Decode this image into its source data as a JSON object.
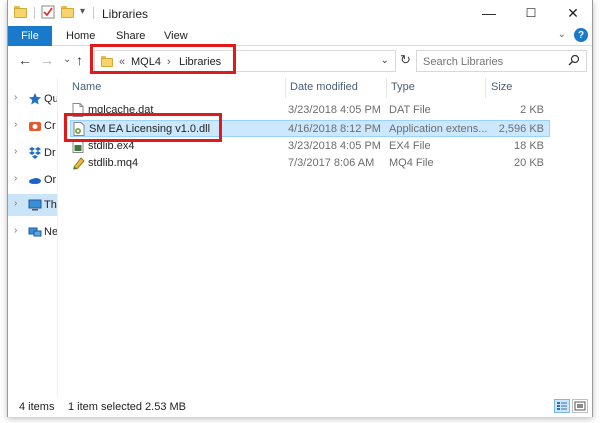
{
  "window": {
    "title": "Libraries",
    "controls": {
      "minimize": "—",
      "maximize": "☐",
      "close": "✕"
    }
  },
  "ribbon": {
    "tabs": [
      "File",
      "Home",
      "Share",
      "View"
    ],
    "expand_chevron": "⌄",
    "help": "?"
  },
  "nav": {
    "back": "←",
    "forward": "→",
    "recent": "⌄",
    "up": "↑",
    "breadcrumb": {
      "overflow": "«",
      "items": [
        "MQL4",
        "Libraries"
      ],
      "separator": "›"
    },
    "address_dropdown": "⌄",
    "refresh": "↻",
    "search_placeholder": "Search Libraries",
    "search_icon": "⚲"
  },
  "sidebar": {
    "items": [
      {
        "label": "Qu",
        "icon": "star-icon"
      },
      {
        "label": "Cr",
        "icon": "creative-cloud-icon"
      },
      {
        "label": "Dr",
        "icon": "dropbox-icon"
      },
      {
        "label": "Or",
        "icon": "onedrive-icon"
      },
      {
        "label": "Th",
        "icon": "this-pc-icon",
        "selected": true
      },
      {
        "label": "Ne",
        "icon": "network-icon"
      }
    ]
  },
  "columns": [
    "Name",
    "Date modified",
    "Type",
    "Size"
  ],
  "files": [
    {
      "name": "mqlcache.dat",
      "date": "3/23/2018 4:05 PM",
      "type": "DAT File",
      "size": "2 KB",
      "icon": "file-icon",
      "selected": false
    },
    {
      "name": "SM EA Licensing v1.0.dll",
      "date": "4/16/2018 8:12 PM",
      "type": "Application extens...",
      "size": "2,596 KB",
      "icon": "dll-file-icon",
      "selected": true
    },
    {
      "name": "stdlib.ex4",
      "date": "3/23/2018 4:05 PM",
      "type": "EX4 File",
      "size": "18 KB",
      "icon": "ex4-file-icon",
      "selected": false
    },
    {
      "name": "stdlib.mq4",
      "date": "7/3/2017 8:06 AM",
      "type": "MQ4 File",
      "size": "20 KB",
      "icon": "mq4-file-icon",
      "selected": false
    }
  ],
  "status": {
    "item_count": "4 items",
    "selection": "1 item selected  2.53 MB"
  },
  "colors": {
    "accent": "#1979ca",
    "highlight": "#e01a1a",
    "selection": "#cce8ff"
  }
}
